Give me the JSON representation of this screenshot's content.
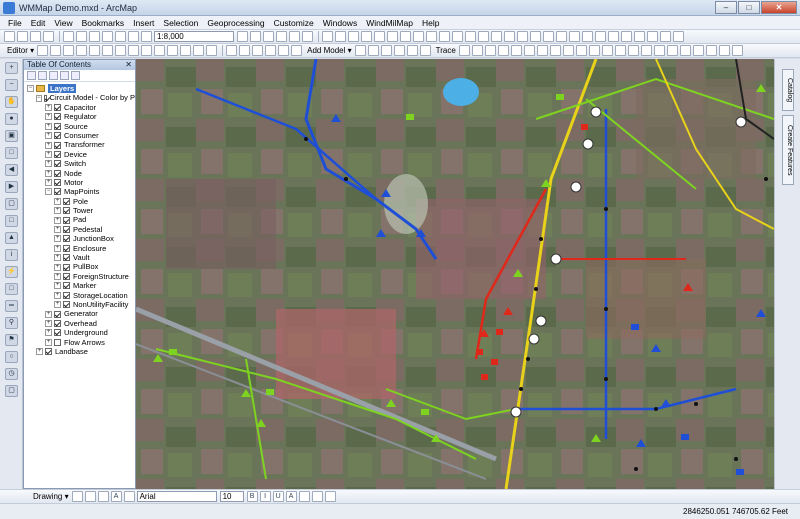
{
  "window": {
    "title": "WMMap Demo.mxd - ArcMap"
  },
  "menu": [
    "File",
    "Edit",
    "View",
    "Bookmarks",
    "Insert",
    "Selection",
    "Geoprocessing",
    "Customize",
    "Windows",
    "WindMilMap",
    "Help"
  ],
  "toolbar": {
    "scale": "1:8,000",
    "editor_label": "Editor ▾",
    "add_model_label": "Add Model ▾",
    "trace_label": "Trace"
  },
  "toc": {
    "title": "Table Of Contents",
    "items": [
      {
        "label": "Layers",
        "level": 0,
        "expanded": true,
        "checked": null,
        "selected": true
      },
      {
        "label": "Circuit Model - Color by P",
        "level": 1,
        "expanded": true,
        "checked": true
      },
      {
        "label": "Capacitor",
        "level": 2,
        "expanded": false,
        "checked": true
      },
      {
        "label": "Regulator",
        "level": 2,
        "expanded": false,
        "checked": true
      },
      {
        "label": "Source",
        "level": 2,
        "expanded": false,
        "checked": true
      },
      {
        "label": "Consumer",
        "level": 2,
        "expanded": false,
        "checked": true
      },
      {
        "label": "Transformer",
        "level": 2,
        "expanded": false,
        "checked": true
      },
      {
        "label": "Device",
        "level": 2,
        "expanded": false,
        "checked": true
      },
      {
        "label": "Switch",
        "level": 2,
        "expanded": false,
        "checked": true
      },
      {
        "label": "Node",
        "level": 2,
        "expanded": false,
        "checked": true
      },
      {
        "label": "Motor",
        "level": 2,
        "expanded": false,
        "checked": true
      },
      {
        "label": "MapPoints",
        "level": 2,
        "expanded": true,
        "checked": true
      },
      {
        "label": "Pole",
        "level": 3,
        "expanded": false,
        "checked": true
      },
      {
        "label": "Tower",
        "level": 3,
        "expanded": false,
        "checked": true
      },
      {
        "label": "Pad",
        "level": 3,
        "expanded": false,
        "checked": true
      },
      {
        "label": "Pedestal",
        "level": 3,
        "expanded": false,
        "checked": true
      },
      {
        "label": "JunctionBox",
        "level": 3,
        "expanded": false,
        "checked": true
      },
      {
        "label": "Enclosure",
        "level": 3,
        "expanded": false,
        "checked": true
      },
      {
        "label": "Vault",
        "level": 3,
        "expanded": false,
        "checked": true
      },
      {
        "label": "PullBox",
        "level": 3,
        "expanded": false,
        "checked": true
      },
      {
        "label": "ForeignStructure",
        "level": 3,
        "expanded": false,
        "checked": true
      },
      {
        "label": "Marker",
        "level": 3,
        "expanded": false,
        "checked": true
      },
      {
        "label": "StorageLocation",
        "level": 3,
        "expanded": false,
        "checked": true
      },
      {
        "label": "NonUtilityFacility",
        "level": 3,
        "expanded": false,
        "checked": true
      },
      {
        "label": "Generator",
        "level": 2,
        "expanded": false,
        "checked": true
      },
      {
        "label": "Overhead",
        "level": 2,
        "expanded": false,
        "checked": true
      },
      {
        "label": "Underground",
        "level": 2,
        "expanded": false,
        "checked": true
      },
      {
        "label": "Flow Arrows",
        "level": 2,
        "expanded": false,
        "checked": false
      },
      {
        "label": "Landbase",
        "level": 1,
        "expanded": false,
        "checked": true
      }
    ]
  },
  "right_dock": [
    "Catalog",
    "Create Features"
  ],
  "drawing": {
    "label": "Drawing ▾",
    "font": "Arial",
    "font_size": "10"
  },
  "status": {
    "coords": "2846250.051  746705.62 Feet"
  },
  "colors": {
    "overhead_blue": "#1f4fd6",
    "underground_green": "#7ed321",
    "line_red": "#e0281a",
    "line_yellow": "#e8d21a"
  }
}
